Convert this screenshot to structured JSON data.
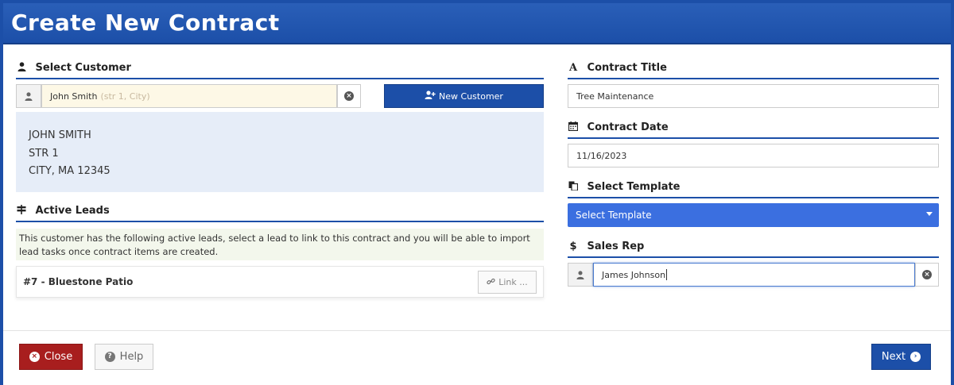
{
  "header": {
    "title": "Create New Contract"
  },
  "customer": {
    "section_title": "Select Customer",
    "section_icon": "user-icon",
    "selected_name": "John Smith",
    "selected_hint": "(str 1, City)",
    "new_customer_label": "New Customer",
    "address_lines": [
      "JOHN SMITH",
      "STR 1",
      "CITY, MA 12345"
    ]
  },
  "leads": {
    "section_title": "Active Leads",
    "section_icon": "signpost-icon",
    "note": "This customer has the following active leads, select a lead to link to this contract and you will be able to import lead tasks once contract items are created.",
    "items": [
      {
        "label": "#7 - Bluestone Patio",
        "action_label": "Link ..."
      }
    ]
  },
  "contract_title": {
    "section_title": "Contract Title",
    "section_icon": "font-icon",
    "value": "Tree Maintenance"
  },
  "contract_date": {
    "section_title": "Contract Date",
    "section_icon": "calendar-icon",
    "value": "11/16/2023"
  },
  "template": {
    "section_title": "Select Template",
    "section_icon": "copy-icon",
    "selected": "Select Template",
    "color": "#3b6fe0"
  },
  "sales_rep": {
    "section_title": "Sales Rep",
    "section_icon": "dollar-icon",
    "value": "James Johnson"
  },
  "footer": {
    "close_label": "Close",
    "help_label": "Help",
    "next_label": "Next"
  },
  "colors": {
    "primary": "#1c4fa8",
    "danger": "#a81e1e",
    "address_bg": "#e6edf8",
    "note_bg": "#f3f7ec"
  }
}
